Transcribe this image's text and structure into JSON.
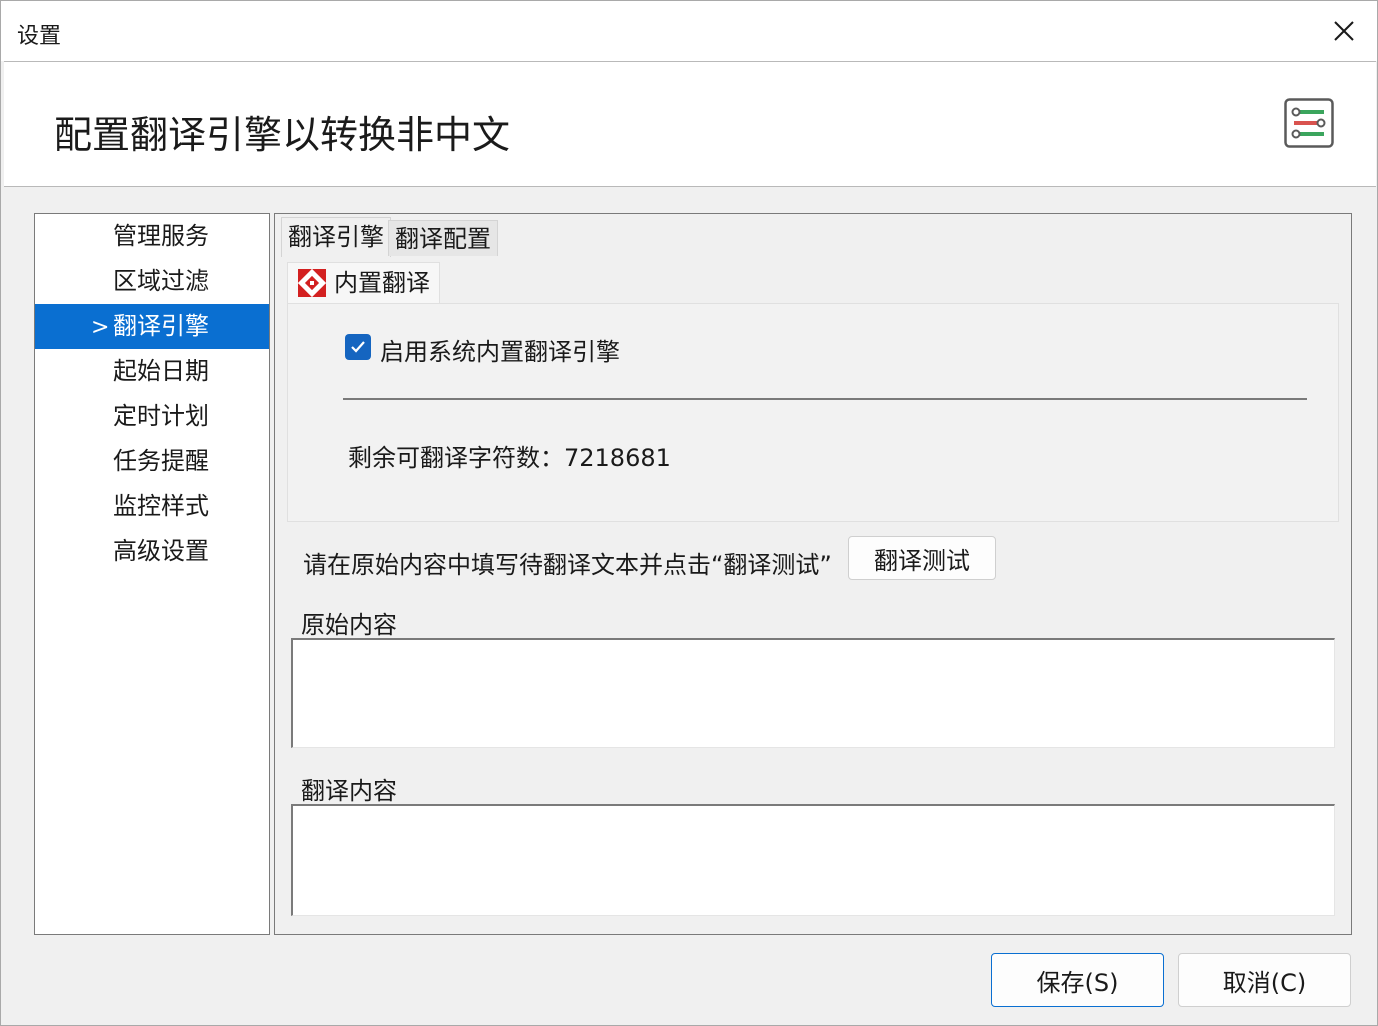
{
  "window": {
    "title": "设置"
  },
  "header": {
    "heading": "配置翻译引擎以转换非中文"
  },
  "nav": {
    "items": [
      {
        "label": "管理服务",
        "active": false
      },
      {
        "label": "区域过滤",
        "active": false
      },
      {
        "label": "翻译引擎",
        "active": true,
        "marker": ">"
      },
      {
        "label": "起始日期",
        "active": false
      },
      {
        "label": "定时计划",
        "active": false
      },
      {
        "label": "任务提醒",
        "active": false
      },
      {
        "label": "监控样式",
        "active": false
      },
      {
        "label": "高级设置",
        "active": false
      }
    ]
  },
  "tabs": [
    {
      "label": "翻译引擎"
    },
    {
      "label": "翻译配置"
    }
  ],
  "engine": {
    "inner_tab_label": "内置翻译",
    "enable_checkbox": {
      "label": "启用系统内置翻译引擎",
      "checked": true
    },
    "remaining_label": "剩余可翻译字符数：7218681"
  },
  "test": {
    "hint": "请在原始内容中填写待翻译文本并点击“翻译测试”",
    "button_label": "翻译测试",
    "source_label": "原始内容",
    "source_value": "",
    "result_label": "翻译内容",
    "result_value": ""
  },
  "footer": {
    "save_label": "保存(S)",
    "cancel_label": "取消(C)"
  },
  "colors": {
    "accent": "#0a6fd1",
    "checkbox": "#1565c0"
  },
  "icons": [
    "close-icon",
    "settings-sliders-icon",
    "builtin-translate-logo-icon",
    "checkmark-icon"
  ]
}
